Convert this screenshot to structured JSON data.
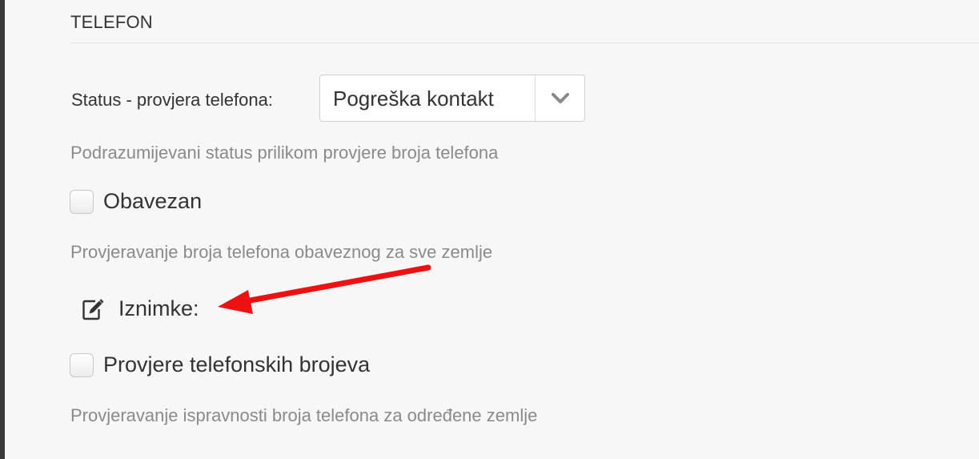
{
  "section": {
    "title": "TELEFON"
  },
  "status_field": {
    "label": "Status - provjera telefona:",
    "selected_value": "Pogreška kontakt",
    "help": "Podrazumijevani status prilikom provjere broja telefona"
  },
  "required_option": {
    "label": "Obavezan",
    "checked": false,
    "help": "Provjeravanje broja telefona obaveznog za sve zemlje"
  },
  "exceptions": {
    "label": "Iznimke:",
    "icon": "edit-icon"
  },
  "phone_checks_option": {
    "label": "Provjere telefonskih brojeva",
    "checked": false,
    "help": "Provjeravanje ispravnosti broja telefona za određene zemlje"
  },
  "annotation": {
    "arrow_color": "#ee1111"
  }
}
